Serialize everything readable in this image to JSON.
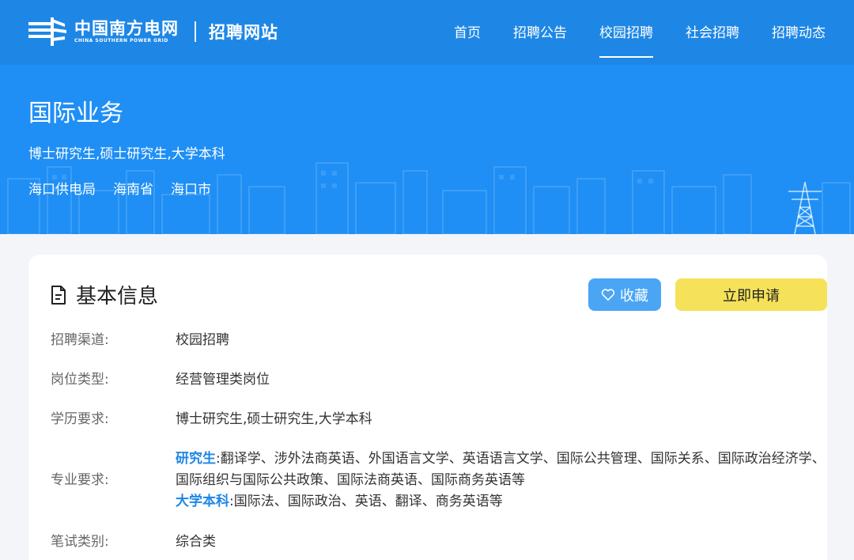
{
  "header": {
    "logo_cn": "中国南方电网",
    "logo_en": "CHINA SOUTHERN POWER GRID",
    "site_title": "招聘网站",
    "nav": [
      {
        "label": "首页"
      },
      {
        "label": "招聘公告"
      },
      {
        "label": "校园招聘",
        "active": true
      },
      {
        "label": "社会招聘"
      },
      {
        "label": "招聘动态"
      }
    ]
  },
  "banner": {
    "title": "国际业务",
    "degree": "博士研究生,硕士研究生,大学本科",
    "location": [
      "海口供电局",
      "海南省",
      "海口市"
    ]
  },
  "card": {
    "title": "基本信息",
    "fav_label": "收藏",
    "apply_label": "立即申请",
    "rows": {
      "channel": {
        "label": "招聘渠道:",
        "value": "校园招聘"
      },
      "type": {
        "label": "岗位类型:",
        "value": "经营管理类岗位"
      },
      "education": {
        "label": "学历要求:",
        "value": "博士研究生,硕士研究生,大学本科"
      },
      "major": {
        "label": "专业要求:",
        "grad_tag": "研究生",
        "grad_value": ":翻译学、涉外法商英语、外国语言文学、英语语言文学、国际公共管理、国际关系、国际政治经济学、国际组织与国际公共政策、国际法商英语、国际商务英语等",
        "ug_tag": "大学本科",
        "ug_value": ":国际法、国际政治、英语、翻译、商务英语等"
      },
      "exam": {
        "label": "笔试类别:",
        "value": "综合类"
      }
    }
  },
  "colors": {
    "header_bg": "#1e87e6",
    "banner_bg": "#1f8ff5",
    "accent": "#1e87e6",
    "fav_button": "#4aa5f5",
    "apply_button": "#f5e25a"
  },
  "icons": [
    "csg-logo-icon",
    "document-icon",
    "heart-icon",
    "city-skyline-icon",
    "power-tower-icon"
  ]
}
